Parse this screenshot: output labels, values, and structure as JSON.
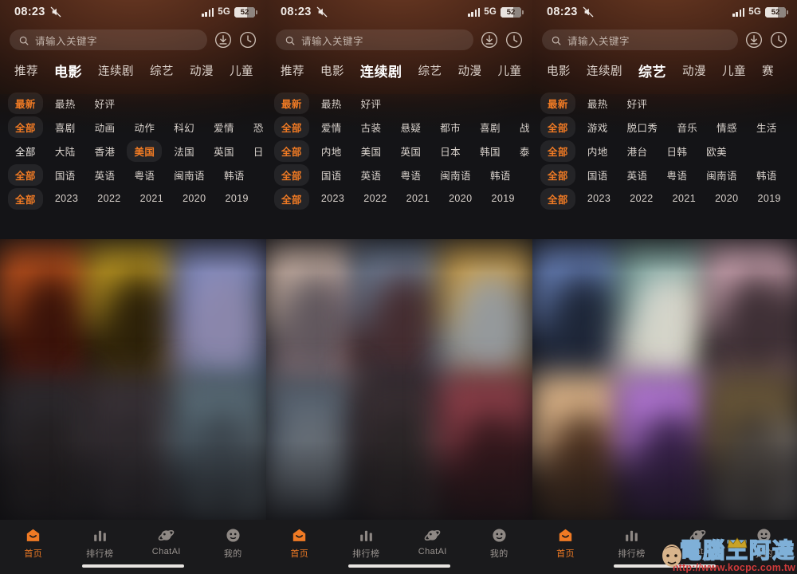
{
  "app": {
    "accent": "#ef7a24",
    "header_bg": "#4a2618",
    "body_bg": "#121215",
    "tabbar_bg": "#1a1a1c"
  },
  "status_bar": {
    "time": "08:23",
    "mute_icon": "bell-slash-icon",
    "signal_icon": "signal-bars-icon",
    "network": "5G",
    "battery_level": "52",
    "battery_icon": "battery-icon"
  },
  "search": {
    "placeholder": "请输入关键字",
    "search_icon": "search-icon",
    "download_icon": "download-circle-icon",
    "history_icon": "clock-circle-icon"
  },
  "panels": [
    {
      "id": "panel-movies",
      "category_tabs": [
        {
          "label": "推荐",
          "active": false
        },
        {
          "label": "电影",
          "active": true
        },
        {
          "label": "连续剧",
          "active": false
        },
        {
          "label": "综艺",
          "active": false
        },
        {
          "label": "动漫",
          "active": false
        },
        {
          "label": "儿童",
          "active": false
        }
      ],
      "filter_rows": [
        {
          "name": "sort",
          "chips": [
            {
              "label": "最新",
              "state": "selected"
            },
            {
              "label": "最热",
              "state": "normal"
            },
            {
              "label": "好评",
              "state": "normal"
            }
          ]
        },
        {
          "name": "genre",
          "chips": [
            {
              "label": "全部",
              "state": "selected"
            },
            {
              "label": "喜剧",
              "state": "normal"
            },
            {
              "label": "动画",
              "state": "normal"
            },
            {
              "label": "动作",
              "state": "normal"
            },
            {
              "label": "科幻",
              "state": "normal"
            },
            {
              "label": "爱情",
              "state": "normal"
            },
            {
              "label": "恐",
              "state": "clipped"
            }
          ]
        },
        {
          "name": "region",
          "chips": [
            {
              "label": "全部",
              "state": "plain"
            },
            {
              "label": "大陆",
              "state": "normal"
            },
            {
              "label": "香港",
              "state": "normal"
            },
            {
              "label": "美国",
              "state": "highlighted"
            },
            {
              "label": "法国",
              "state": "normal"
            },
            {
              "label": "英国",
              "state": "normal"
            },
            {
              "label": "日",
              "state": "clipped"
            }
          ]
        },
        {
          "name": "language",
          "chips": [
            {
              "label": "全部",
              "state": "selected"
            },
            {
              "label": "国语",
              "state": "normal"
            },
            {
              "label": "英语",
              "state": "normal"
            },
            {
              "label": "粤语",
              "state": "normal"
            },
            {
              "label": "闽南语",
              "state": "normal"
            },
            {
              "label": "韩语",
              "state": "normal"
            }
          ]
        },
        {
          "name": "year",
          "chips": [
            {
              "label": "全部",
              "state": "selected"
            },
            {
              "label": "2023",
              "state": "normal"
            },
            {
              "label": "2022",
              "state": "normal"
            },
            {
              "label": "2021",
              "state": "normal"
            },
            {
              "label": "2020",
              "state": "normal"
            },
            {
              "label": "2019",
              "state": "normal"
            }
          ]
        }
      ]
    },
    {
      "id": "panel-series",
      "category_tabs": [
        {
          "label": "推荐",
          "active": false
        },
        {
          "label": "电影",
          "active": false
        },
        {
          "label": "连续剧",
          "active": true
        },
        {
          "label": "综艺",
          "active": false
        },
        {
          "label": "动漫",
          "active": false
        },
        {
          "label": "儿童",
          "active": false
        }
      ],
      "filter_rows": [
        {
          "name": "sort",
          "chips": [
            {
              "label": "最新",
              "state": "selected"
            },
            {
              "label": "最热",
              "state": "normal"
            },
            {
              "label": "好评",
              "state": "normal"
            }
          ]
        },
        {
          "name": "genre",
          "chips": [
            {
              "label": "全部",
              "state": "selected"
            },
            {
              "label": "爱情",
              "state": "normal"
            },
            {
              "label": "古装",
              "state": "normal"
            },
            {
              "label": "悬疑",
              "state": "normal"
            },
            {
              "label": "都市",
              "state": "normal"
            },
            {
              "label": "喜剧",
              "state": "normal"
            },
            {
              "label": "战",
              "state": "clipped"
            }
          ]
        },
        {
          "name": "region",
          "chips": [
            {
              "label": "全部",
              "state": "selected"
            },
            {
              "label": "内地",
              "state": "normal"
            },
            {
              "label": "美国",
              "state": "normal"
            },
            {
              "label": "英国",
              "state": "normal"
            },
            {
              "label": "日本",
              "state": "normal"
            },
            {
              "label": "韩国",
              "state": "normal"
            },
            {
              "label": "泰",
              "state": "clipped"
            }
          ]
        },
        {
          "name": "language",
          "chips": [
            {
              "label": "全部",
              "state": "selected"
            },
            {
              "label": "国语",
              "state": "normal"
            },
            {
              "label": "英语",
              "state": "normal"
            },
            {
              "label": "粤语",
              "state": "normal"
            },
            {
              "label": "闽南语",
              "state": "normal"
            },
            {
              "label": "韩语",
              "state": "normal"
            }
          ]
        },
        {
          "name": "year",
          "chips": [
            {
              "label": "全部",
              "state": "selected"
            },
            {
              "label": "2023",
              "state": "normal"
            },
            {
              "label": "2022",
              "state": "normal"
            },
            {
              "label": "2021",
              "state": "normal"
            },
            {
              "label": "2020",
              "state": "normal"
            },
            {
              "label": "2019",
              "state": "normal"
            }
          ]
        }
      ]
    },
    {
      "id": "panel-variety",
      "category_tabs": [
        {
          "label": "电影",
          "active": false
        },
        {
          "label": "连续剧",
          "active": false
        },
        {
          "label": "综艺",
          "active": true
        },
        {
          "label": "动漫",
          "active": false
        },
        {
          "label": "儿童",
          "active": false
        },
        {
          "label": "赛",
          "active": false
        }
      ],
      "filter_rows": [
        {
          "name": "sort",
          "chips": [
            {
              "label": "最新",
              "state": "selected"
            },
            {
              "label": "最热",
              "state": "normal"
            },
            {
              "label": "好评",
              "state": "normal"
            }
          ]
        },
        {
          "name": "genre",
          "chips": [
            {
              "label": "全部",
              "state": "selected"
            },
            {
              "label": "游戏",
              "state": "normal"
            },
            {
              "label": "脱口秀",
              "state": "normal"
            },
            {
              "label": "音乐",
              "state": "normal"
            },
            {
              "label": "情感",
              "state": "normal"
            },
            {
              "label": "生活",
              "state": "normal"
            }
          ]
        },
        {
          "name": "region",
          "chips": [
            {
              "label": "全部",
              "state": "selected"
            },
            {
              "label": "内地",
              "state": "normal"
            },
            {
              "label": "港台",
              "state": "normal"
            },
            {
              "label": "日韩",
              "state": "normal"
            },
            {
              "label": "欧美",
              "state": "normal"
            }
          ]
        },
        {
          "name": "language",
          "chips": [
            {
              "label": "全部",
              "state": "selected"
            },
            {
              "label": "国语",
              "state": "normal"
            },
            {
              "label": "英语",
              "state": "normal"
            },
            {
              "label": "粤语",
              "state": "normal"
            },
            {
              "label": "闽南语",
              "state": "normal"
            },
            {
              "label": "韩语",
              "state": "normal"
            }
          ]
        },
        {
          "name": "year",
          "chips": [
            {
              "label": "全部",
              "state": "selected"
            },
            {
              "label": "2023",
              "state": "normal"
            },
            {
              "label": "2022",
              "state": "normal"
            },
            {
              "label": "2021",
              "state": "normal"
            },
            {
              "label": "2020",
              "state": "normal"
            },
            {
              "label": "2019",
              "state": "normal"
            }
          ]
        }
      ]
    }
  ],
  "poster_grid": {
    "note": "blurred movie poster thumbnails",
    "panels": [
      [
        {
          "a": "#c4551f",
          "b": "#7a1f14",
          "c": "#2a1008"
        },
        {
          "a": "#c8a024",
          "b": "#6b4a10",
          "c": "#1d1708"
        },
        {
          "a": "#7b86b8",
          "b": "#46607c",
          "c": "#9a8fb5"
        },
        {
          "a": "#2d2a2e",
          "b": "#4a4548",
          "c": "#1a1718"
        },
        {
          "a": "#3a3338",
          "b": "#6a6468",
          "c": "#201d20"
        },
        {
          "a": "#5b6e78",
          "b": "#8fa0a8",
          "c": "#2a3138"
        }
      ],
      [
        {
          "a": "#cdb4a6",
          "b": "#c38c8c",
          "c": "#4a4a52"
        },
        {
          "a": "#6d7d96",
          "b": "#2a3446",
          "c": "#4a2a2a"
        },
        {
          "a": "#c79a46",
          "b": "#7a5a2a",
          "c": "#9aa8b6"
        },
        {
          "a": "#54606e",
          "b": "#2a2f38",
          "c": "#70787f"
        },
        {
          "a": "#3a2f34",
          "b": "#6b5a5a",
          "c": "#1d1a1c"
        },
        {
          "a": "#8e3f4a",
          "b": "#55282f",
          "c": "#2a1418"
        }
      ],
      [
        {
          "a": "#6c86c0",
          "b": "#2a3a58",
          "c": "#1a2030"
        },
        {
          "a": "#78a09a",
          "b": "#8c9a6a",
          "c": "#e6e2e0"
        },
        {
          "a": "#d8aeba",
          "b": "#8a6a72",
          "c": "#2a2026"
        },
        {
          "a": "#e2b98c",
          "b": "#8a5f3c",
          "c": "#3a2418"
        },
        {
          "a": "#b87ada",
          "b": "#6a3f8c",
          "c": "#2a1a38"
        },
        {
          "a": "#6b5a3a",
          "b": "#d8d2ce",
          "c": "#2a2420"
        }
      ]
    ]
  },
  "tabbar": {
    "items": [
      {
        "label": "首页",
        "icon": "home-icon",
        "active": true
      },
      {
        "label": "排行榜",
        "icon": "chart-bars-icon",
        "active": false
      },
      {
        "label": "ChatAI",
        "icon": "planet-icon",
        "active": false
      },
      {
        "label": "我的",
        "icon": "face-icon",
        "active": false
      }
    ]
  },
  "watermark": {
    "brand": "電腦王阿達",
    "url": "http://www.kocpc.com.tw"
  }
}
